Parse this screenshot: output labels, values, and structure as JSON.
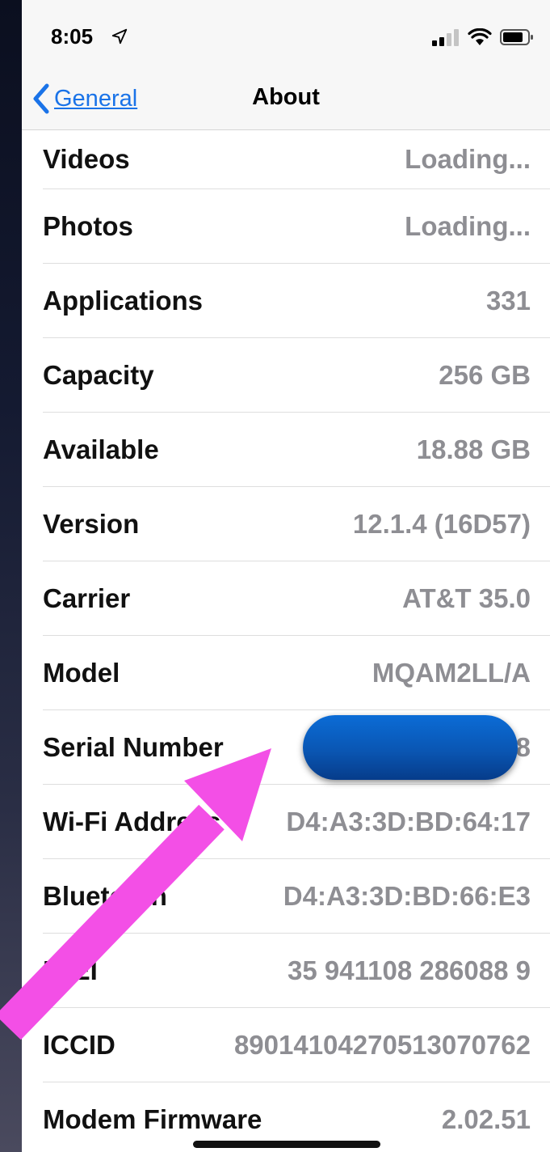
{
  "status_bar": {
    "time": "8:05"
  },
  "nav": {
    "back_label": "General",
    "title": "About"
  },
  "rows": [
    {
      "label": "Videos",
      "value": "Loading..."
    },
    {
      "label": "Photos",
      "value": "Loading..."
    },
    {
      "label": "Applications",
      "value": "331"
    },
    {
      "label": "Capacity",
      "value": "256 GB"
    },
    {
      "label": "Available",
      "value": "18.88 GB"
    },
    {
      "label": "Version",
      "value": "12.1.4 (16D57)"
    },
    {
      "label": "Carrier",
      "value": "AT&T 35.0"
    },
    {
      "label": "Model",
      "value": "MQAM2LL/A"
    },
    {
      "label": "Serial Number",
      "value": "D                    8"
    },
    {
      "label": "Wi-Fi Address",
      "value": "D4:A3:3D:BD:64:17"
    },
    {
      "label": "Bluetooth",
      "value": "D4:A3:3D:BD:66:E3"
    },
    {
      "label": "IMEI",
      "value": "35 941108 286088 9"
    },
    {
      "label": "ICCID",
      "value": "89014104270513070762"
    },
    {
      "label": "Modem Firmware",
      "value": "2.02.51"
    }
  ],
  "colors": {
    "accent": "#1a73e8",
    "annotation_arrow": "#f34fe6",
    "redaction": "#0a56b3"
  }
}
